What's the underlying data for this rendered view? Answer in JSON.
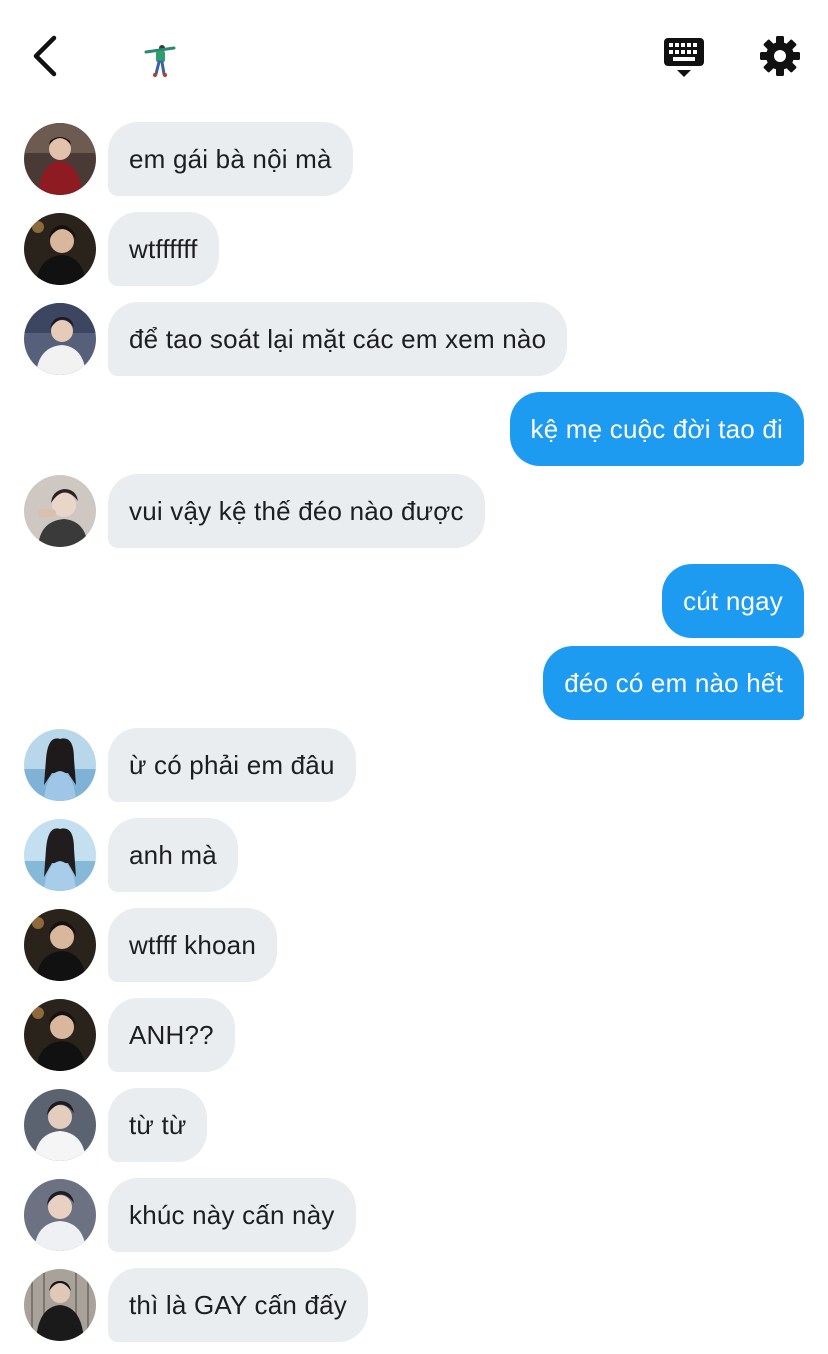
{
  "header": {
    "back_icon": "chevron-left-icon",
    "sticker_icon": "dancing-figure-sticker",
    "keyboard_icon": "keyboard-icon",
    "settings_icon": "gear-icon"
  },
  "colors": {
    "incoming_bubble": "#e9edf0",
    "outgoing_bubble": "#1d9bf0",
    "incoming_text": "#1c1e21",
    "outgoing_text": "#ffffff"
  },
  "messages": [
    {
      "direction": "in",
      "text": "em gái bà nội mà"
    },
    {
      "direction": "in",
      "text": "wtffffff"
    },
    {
      "direction": "in",
      "text": "để tao soát lại mặt các em xem nào"
    },
    {
      "direction": "out",
      "text": "kệ mẹ cuộc đời tao đi"
    },
    {
      "direction": "in",
      "text": "vui vậy kệ thế đéo nào được"
    },
    {
      "direction": "out",
      "text": "cút ngay"
    },
    {
      "direction": "out",
      "text": "đéo có em nào hết"
    },
    {
      "direction": "in",
      "text": "ừ có phải em đâu"
    },
    {
      "direction": "in",
      "text": "anh mà"
    },
    {
      "direction": "in",
      "text": "wtfff khoan"
    },
    {
      "direction": "in",
      "text": "ANH??"
    },
    {
      "direction": "in",
      "text": "từ từ"
    },
    {
      "direction": "in",
      "text": "khúc này cấn này"
    },
    {
      "direction": "in",
      "text": " thì là GAY cấn đấy"
    }
  ]
}
